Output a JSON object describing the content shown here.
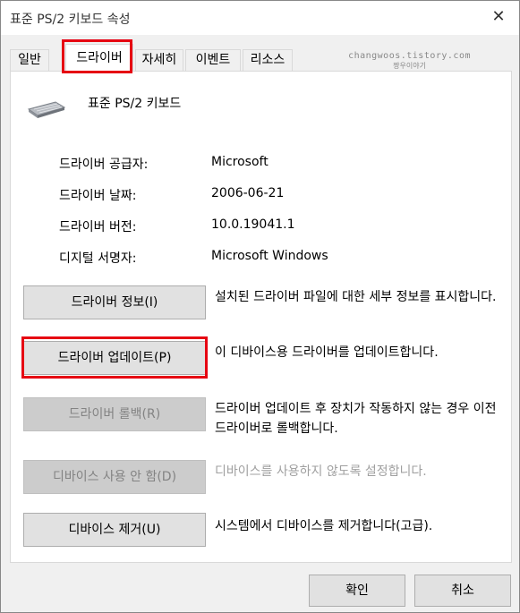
{
  "window": {
    "title": "표준 PS/2 키보드 속성",
    "close_glyph": "✕"
  },
  "tabs": [
    {
      "label": "일반"
    },
    {
      "label": "드라이버"
    },
    {
      "label": "자세히"
    },
    {
      "label": "이벤트"
    },
    {
      "label": "리소스"
    }
  ],
  "watermark": {
    "line1": "changwoos.tistory.com",
    "line2": "짱우이야기"
  },
  "device": {
    "name": "표준 PS/2 키보드",
    "icon": "keyboard-icon"
  },
  "info": [
    {
      "label": "드라이버 공급자:",
      "value": "Microsoft"
    },
    {
      "label": "드라이버 날짜:",
      "value": "2006-06-21"
    },
    {
      "label": "드라이버 버전:",
      "value": "10.0.19041.1"
    },
    {
      "label": "디지털 서명자:",
      "value": "Microsoft Windows"
    }
  ],
  "actions": [
    {
      "label": "드라이버 정보(I)",
      "desc": "설치된 드라이버 파일에 대한 세부 정보를 표시합니다.",
      "enabled": true
    },
    {
      "label": "드라이버 업데이트(P)",
      "desc": "이 디바이스용 드라이버를 업데이트합니다.",
      "enabled": true
    },
    {
      "label": "드라이버 롤백(R)",
      "desc": "드라이버 업데이트 후 장치가 작동하지 않는 경우 이전 드라이버로 롤백합니다.",
      "enabled": false
    },
    {
      "label": "디바이스 사용 안 함(D)",
      "desc": "디바이스를 사용하지 않도록 설정합니다.",
      "enabled": false
    },
    {
      "label": "디바이스 제거(U)",
      "desc": "시스템에서 디바이스를 제거합니다(고급).",
      "enabled": true
    }
  ],
  "footer": {
    "ok_label": "확인",
    "cancel_label": "취소"
  },
  "colors": {
    "highlight_red": "#e60012",
    "panel_bg": "#ffffff",
    "dialog_bg": "#f0f0f0"
  }
}
